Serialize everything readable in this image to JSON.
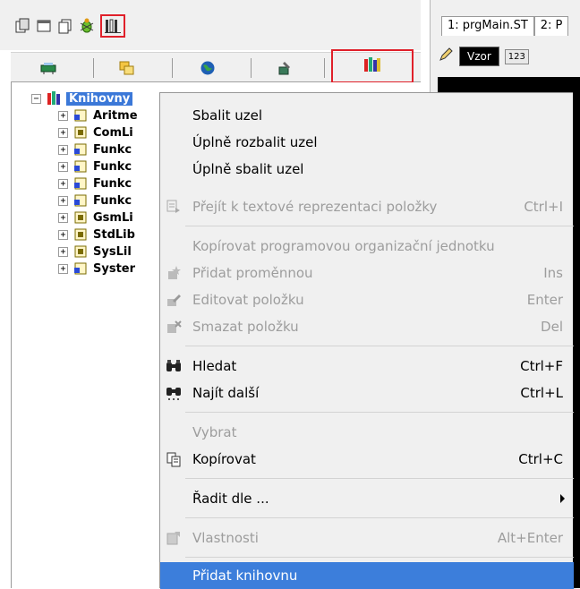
{
  "right_pane": {
    "tabs": [
      "1: prgMain.ST",
      "2: P"
    ],
    "vzor_label": "Vzor",
    "num_label": "123"
  },
  "tree": {
    "root_label": "Knihovny",
    "items": [
      {
        "label": "Aritme",
        "icon": "library-book-blue-icon"
      },
      {
        "label": "ComLi",
        "icon": "library-book-icon"
      },
      {
        "label": "Funkc",
        "icon": "library-book-blue-icon"
      },
      {
        "label": "Funkc",
        "icon": "library-book-blue-icon"
      },
      {
        "label": "Funkc",
        "icon": "library-book-blue-icon"
      },
      {
        "label": "Funkc",
        "icon": "library-book-blue-icon"
      },
      {
        "label": "GsmLi",
        "icon": "library-book-icon"
      },
      {
        "label": "StdLib",
        "icon": "library-book-icon"
      },
      {
        "label": "SysLil",
        "icon": "library-book-icon"
      },
      {
        "label": "Syster",
        "icon": "library-book-blue-icon"
      }
    ]
  },
  "context_menu": {
    "collapse_node": "Sbalit uzel",
    "expand_all": "Úplně rozbalit uzel",
    "collapse_all": "Úplně sbalit uzel",
    "goto_text": "Přejít k textové reprezentaci položky",
    "goto_text_shortcut": "Ctrl+I",
    "copy_pou": "Kopírovat programovou organizační jednotku",
    "add_variable": "Přidat proměnnou",
    "add_variable_shortcut": "Ins",
    "edit_item": "Editovat položku",
    "edit_item_shortcut": "Enter",
    "delete_item": "Smazat položku",
    "delete_item_shortcut": "Del",
    "find": "Hledat",
    "find_shortcut": "Ctrl+F",
    "find_next": "Najít další",
    "find_next_shortcut": "Ctrl+L",
    "select": "Vybrat",
    "copy": "Kopírovat",
    "copy_shortcut": "Ctrl+C",
    "sort_by": "Řadit dle ...",
    "properties": "Vlastnosti",
    "properties_shortcut": "Alt+Enter",
    "add_library": "Přidat knihovnu"
  },
  "colors": {
    "highlight": "#3c7edb",
    "annotation_box": "#e0202a",
    "disabled_text": "#9d9d9d"
  }
}
